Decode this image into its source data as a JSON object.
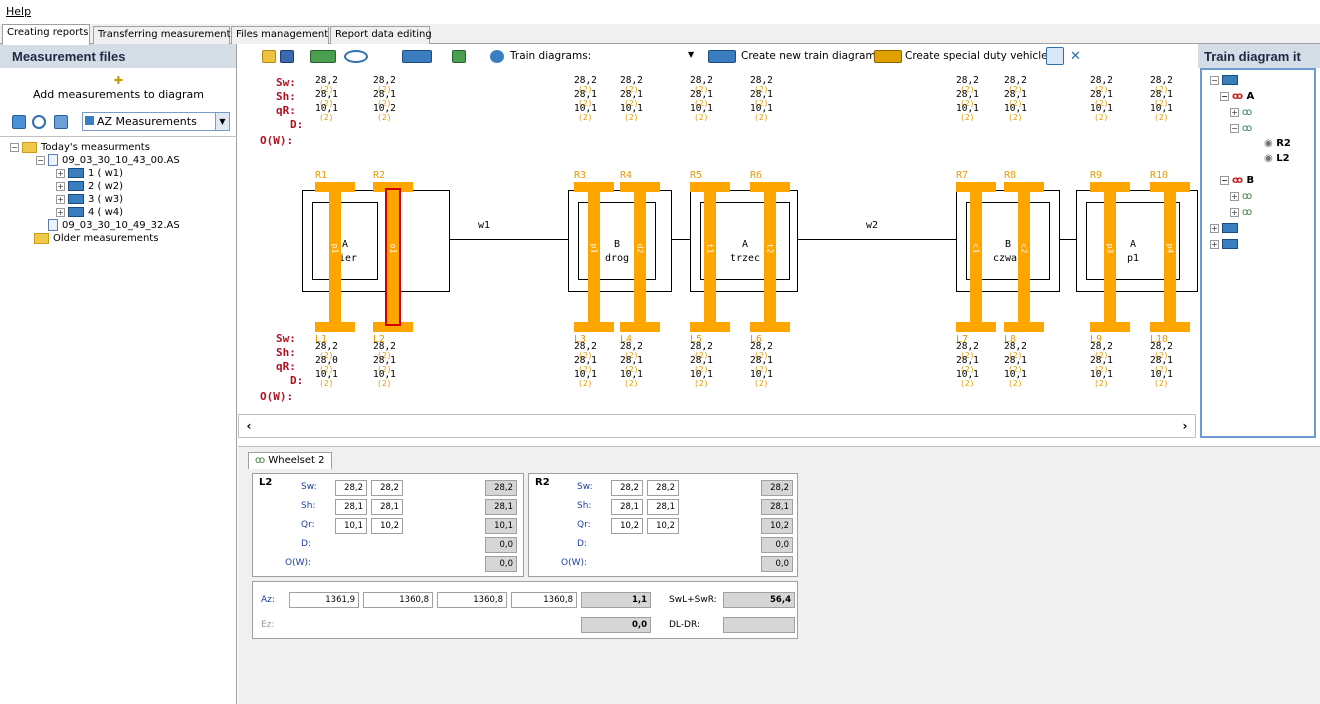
{
  "menu": {
    "help": "Help"
  },
  "tabs": [
    "Creating reports",
    "Transferring measurements",
    "Files management",
    "Report data editing"
  ],
  "left_panel": {
    "title": "Measurement files",
    "add_label": "Add measurements to diagram",
    "combo_value": "AZ Measurements",
    "tree": [
      {
        "label": "Today's measurments",
        "box": "−",
        "icon": "folder-icon"
      },
      {
        "label": "09_03_30_10_43_00.AS",
        "box": "−",
        "icon": "document-icon"
      },
      {
        "label": "1 ( w1)",
        "box": "+",
        "icon": "train-icon"
      },
      {
        "label": "2 ( w2)",
        "box": "+",
        "icon": "train-icon"
      },
      {
        "label": "3 ( w3)",
        "box": "+",
        "icon": "train-icon"
      },
      {
        "label": "4 ( w4)",
        "box": "+",
        "icon": "train-icon"
      },
      {
        "label": "09_03_30_10_49_32.AS",
        "box": "",
        "icon": "document-icon"
      },
      {
        "label": "Older measurements",
        "box": "",
        "icon": "folder-icon"
      }
    ]
  },
  "toolbar": {
    "train_diagrams_label": "Train diagrams:",
    "create_new_label": "Create new train diagram",
    "create_special_label": "Create special duty vehicle"
  },
  "diagram": {
    "row_labels": {
      "sw": "Sw:",
      "sh": "Sh:",
      "qr": "qR:",
      "d": "D:",
      "ow": "O(W):"
    },
    "wagon_labels": [
      "w1",
      "w2"
    ],
    "cars": [
      {
        "letter": "A",
        "name": "pier"
      },
      {
        "letter": "B",
        "name": "drog"
      },
      {
        "letter": "A",
        "name": "trzec"
      },
      {
        "letter": "B",
        "name": "czwar"
      },
      {
        "letter": "A",
        "name": "p1"
      }
    ],
    "axles": [
      {
        "r": "R1",
        "l": "L1",
        "top": [
          "28,2",
          "28,1",
          "10,1"
        ],
        "bot": [
          "28,2",
          "28,0",
          "10,1"
        ],
        "side": "p1"
      },
      {
        "r": "R2",
        "l": "L2",
        "top": [
          "28,2",
          "28,1",
          "10,2"
        ],
        "bot": [
          "28,2",
          "28,1",
          "10,1"
        ],
        "side": "o1"
      },
      {
        "r": "R3",
        "l": "L3",
        "top": [
          "28,2",
          "28,1",
          "10,1"
        ],
        "bot": [
          "28,2",
          "28,1",
          "10,1"
        ],
        "side": "p1"
      },
      {
        "r": "R4",
        "l": "L4",
        "top": [
          "28,2",
          "28,1",
          "10,1"
        ],
        "bot": [
          "28,2",
          "28,1",
          "10,1"
        ],
        "side": "d2"
      },
      {
        "r": "R5",
        "l": "L5",
        "top": [
          "28,2",
          "28,1",
          "10,1"
        ],
        "bot": [
          "28,2",
          "28,1",
          "10,1"
        ],
        "side": "t1"
      },
      {
        "r": "R6",
        "l": "L6",
        "top": [
          "28,2",
          "28,1",
          "10,1"
        ],
        "bot": [
          "28,2",
          "28,1",
          "10,1"
        ],
        "side": "t2"
      },
      {
        "r": "R7",
        "l": "L7",
        "top": [
          "28,2",
          "28,1",
          "10,1"
        ],
        "bot": [
          "28,2",
          "28,1",
          "10,1"
        ],
        "side": "c1"
      },
      {
        "r": "R8",
        "l": "L8",
        "top": [
          "28,2",
          "28,1",
          "10,1"
        ],
        "bot": [
          "28,2",
          "28,1",
          "10,1"
        ],
        "side": "c2"
      },
      {
        "r": "R9",
        "l": "L9",
        "top": [
          "28,2",
          "28,1",
          "10,1"
        ],
        "bot": [
          "28,2",
          "28,1",
          "10,1"
        ],
        "side": "p3"
      },
      {
        "r": "R10",
        "l": "L10",
        "top": [
          "28,2",
          "28,1",
          "10,1"
        ],
        "bot": [
          "28,2",
          "28,1",
          "10,1"
        ],
        "side": "p4"
      }
    ],
    "count": "(2)"
  },
  "right_panel": {
    "title": "Train diagram it",
    "tree": [
      "A",
      "R2",
      "L2",
      "B"
    ]
  },
  "bottom": {
    "tab": "Wheelset 2",
    "left": {
      "title": "L2",
      "labels": [
        "Sw:",
        "Sh:",
        "Qr:",
        "D:",
        "O(W):"
      ],
      "rows": [
        [
          "28,2",
          "28,2",
          "28,2"
        ],
        [
          "28,1",
          "28,1",
          "28,1"
        ],
        [
          "10,1",
          "10,2",
          "10,1"
        ],
        [
          "",
          "",
          "0,0"
        ],
        [
          "",
          "",
          "0,0"
        ]
      ]
    },
    "right": {
      "title": "R2",
      "labels": [
        "Sw:",
        "Sh:",
        "Qr:",
        "D:",
        "O(W):"
      ],
      "rows": [
        [
          "28,2",
          "28,2",
          "28,2"
        ],
        [
          "28,1",
          "28,1",
          "28,1"
        ],
        [
          "10,2",
          "10,2",
          "10,2"
        ],
        [
          "",
          "",
          "0,0"
        ],
        [
          "",
          "",
          "0,0"
        ]
      ]
    },
    "az_label": "Az:",
    "az_values": [
      "1361,9",
      "1360,8",
      "1360,8",
      "1360,8"
    ],
    "az_result": "1,1",
    "swl_label": "SwL+SwR:",
    "swl_value": "56,4",
    "ez_label": "Ez:",
    "ez_result": "0,0",
    "dl_label": "DL-DR:",
    "dl_value": ""
  }
}
